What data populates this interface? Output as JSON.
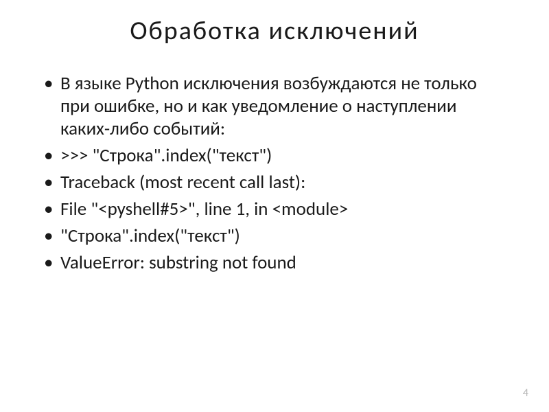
{
  "title": "Обработка  исключений",
  "bullets": [
    "В языке Python исключения возбуждаются не только  при  ошибке, но  и  как уведомление  о наступлении каких-либо  событий:",
    ">>>   \"Строка\".index(\"текст\")",
    "Traceback  (most  recent  call  last):",
    "   File  \"<pyshell#5>\",  line  1,  in <module>",
    "      \"Строка\".index(\"текст\")",
    "ValueError:  substring  not  found"
  ],
  "page_number": "4"
}
